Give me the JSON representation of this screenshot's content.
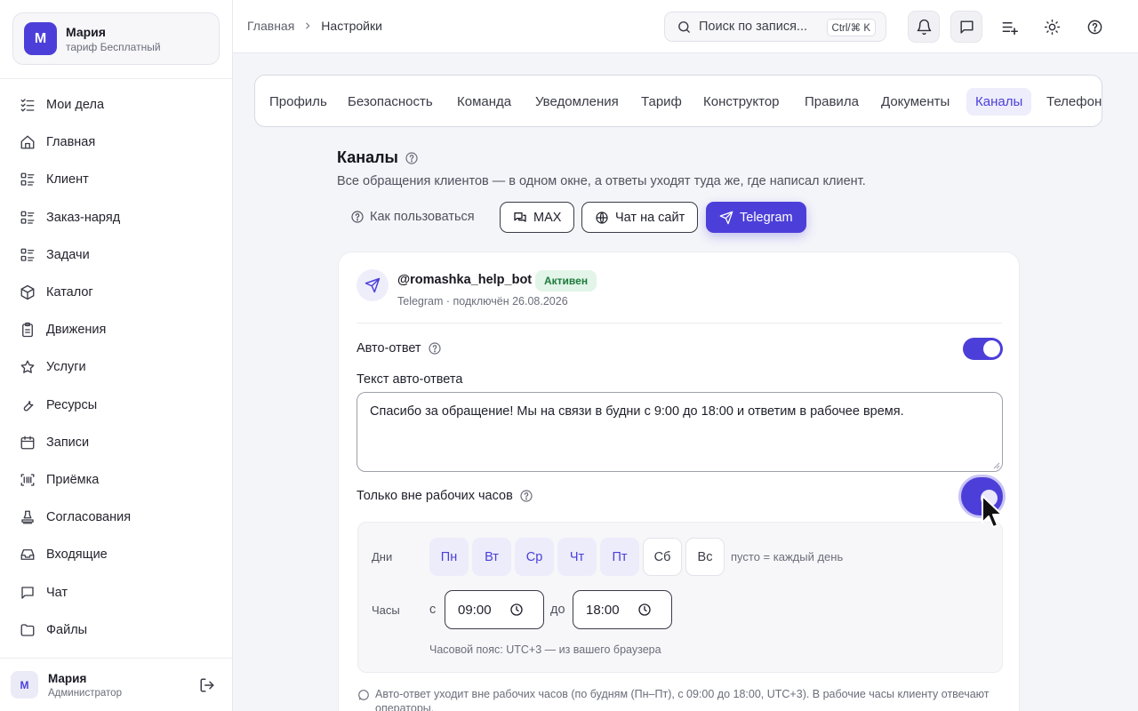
{
  "org": {
    "initial": "М",
    "name": "Мария",
    "plan": "тариф Бесплатный"
  },
  "nav": [
    {
      "label": "Мои дела",
      "icon": "checklist-icon"
    },
    {
      "label": "Главная",
      "icon": "home-icon"
    },
    {
      "label": "Клиент",
      "icon": "list-icon"
    },
    {
      "label": "Заказ-наряд",
      "icon": "list-icon"
    },
    {
      "label": "Задачи",
      "icon": "list-icon"
    },
    {
      "label": "Каталог",
      "icon": "box-icon"
    },
    {
      "label": "Движения",
      "icon": "clipboard-icon"
    },
    {
      "label": "Услуги",
      "icon": "star-icon"
    },
    {
      "label": "Ресурсы",
      "icon": "wrench-icon"
    },
    {
      "label": "Записи",
      "icon": "calendar-icon"
    },
    {
      "label": "Приёмка",
      "icon": "scan-icon"
    },
    {
      "label": "Согласования",
      "icon": "stamp-icon"
    },
    {
      "label": "Входящие",
      "icon": "inbox-icon"
    },
    {
      "label": "Чат",
      "icon": "chat-icon"
    },
    {
      "label": "Файлы",
      "icon": "folder-icon"
    }
  ],
  "user": {
    "initial": "М",
    "name": "Мария",
    "role": "Администратор"
  },
  "breadcrumb": {
    "home": "Главная",
    "current": "Настройки"
  },
  "search": {
    "placeholder": "Поиск по запися...",
    "shortcut": "Ctrl/⌘ K"
  },
  "tabs": [
    {
      "label": "Профиль"
    },
    {
      "label": "Безопасность"
    },
    {
      "label": "Команда"
    },
    {
      "label": "Уведомления"
    },
    {
      "label": "Тариф"
    },
    {
      "label": "Конструктор"
    },
    {
      "label": "Правила"
    },
    {
      "label": "Документы"
    },
    {
      "label": "Каналы"
    },
    {
      "label": "Телефония"
    }
  ],
  "active_tab": "Каналы",
  "section": {
    "title": "Каналы",
    "description": "Все обращения клиентов — в одном окне, а ответы уходят туда же, где написал клиент.",
    "how_to": "Как пользоваться",
    "channels": [
      "MAX",
      "Чат на сайт",
      "Telegram"
    ],
    "selected_channel": "Telegram"
  },
  "bot": {
    "name": "@romashka_help_bot",
    "status": "Активен",
    "meta": "Telegram · подключён 26.08.2026"
  },
  "auto_reply": {
    "label": "Авто-ответ",
    "enabled": true,
    "text_label": "Текст авто-ответа",
    "text": "Спасибо за обращение! Мы на связи в будни с 9:00 до 18:00 и ответим в рабочее время.",
    "off_hours_label": "Только вне рабочих часов",
    "off_hours_enabled": true
  },
  "schedule": {
    "days_label": "Дни",
    "days": [
      {
        "label": "Пн",
        "on": true
      },
      {
        "label": "Вт",
        "on": true
      },
      {
        "label": "Ср",
        "on": true
      },
      {
        "label": "Чт",
        "on": true
      },
      {
        "label": "Пт",
        "on": true
      },
      {
        "label": "Сб",
        "on": false
      },
      {
        "label": "Вс",
        "on": false
      }
    ],
    "days_hint": "пусто = каждый день",
    "hours_label": "Часы",
    "from_label": "с",
    "from": "09:00",
    "to_label": "до",
    "to": "18:00",
    "timezone": "Часовой пояс: UTC+3 — из вашего браузера"
  },
  "note": "Авто-ответ уходит вне рабочих часов (по будням (Пн–Пт), с 09:00 до 18:00, UTC+3). В рабочие часы клиенту отвечают операторы.",
  "colors": {
    "accent": "#4c3fd9",
    "success_bg": "#e2f5e8",
    "success_text": "#1e7a3c"
  }
}
